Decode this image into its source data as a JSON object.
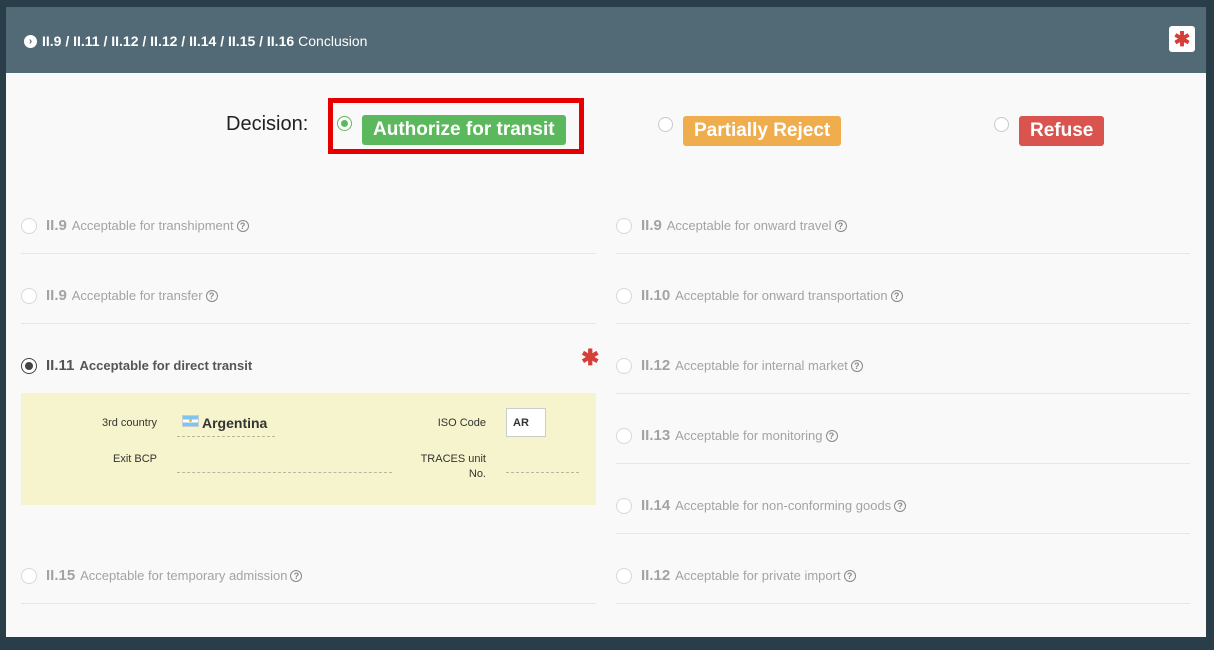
{
  "header": {
    "codes": "II.9 / II.11 / II.12 / II.12 / II.14 / II.15 / II.16",
    "title": "Conclusion",
    "required_icon": "asterisk-icon"
  },
  "decision": {
    "label": "Decision:",
    "options": [
      {
        "label": "Authorize for transit",
        "selected": true,
        "color": "#5cb85c"
      },
      {
        "label": "Partially Reject",
        "selected": false,
        "color": "#f0ad4e"
      },
      {
        "label": "Refuse",
        "selected": false,
        "color": "#d9534f"
      }
    ]
  },
  "left_options": [
    {
      "code": "II.9",
      "text": "Acceptable for transhipment",
      "selected": false
    },
    {
      "code": "II.9",
      "text": "Acceptable for transfer",
      "selected": false
    },
    {
      "code": "II.11",
      "text": "Acceptable for direct transit",
      "selected": true
    },
    {
      "code": "II.15",
      "text": "Acceptable for temporary admission",
      "selected": false
    }
  ],
  "right_options": [
    {
      "code": "II.9",
      "text": "Acceptable for onward travel",
      "selected": false
    },
    {
      "code": "II.10",
      "text": "Acceptable for onward transportation",
      "selected": false
    },
    {
      "code": "II.12",
      "text": "Acceptable for internal market",
      "selected": false
    },
    {
      "code": "II.13",
      "text": "Acceptable for monitoring",
      "selected": false
    },
    {
      "code": "II.14",
      "text": "Acceptable for non-conforming goods",
      "selected": false
    },
    {
      "code": "II.12",
      "text": "Acceptable for private import",
      "selected": false
    }
  ],
  "transit": {
    "third_country_label": "3rd country",
    "third_country_value": "Argentina",
    "iso_code_label": "ISO Code",
    "iso_code_value": "AR",
    "exit_bcp_label": "Exit BCP",
    "exit_bcp_value": "",
    "traces_unit_label_1": "TRACES unit",
    "traces_unit_label_2": "No.",
    "traces_unit_value": ""
  },
  "help_glyph": "?",
  "required_glyph": "✱",
  "colors": {
    "header": "#526976",
    "accent_required": "#d43f3a",
    "highlight": "#e40000",
    "transit_bg": "#f6f4cc"
  }
}
